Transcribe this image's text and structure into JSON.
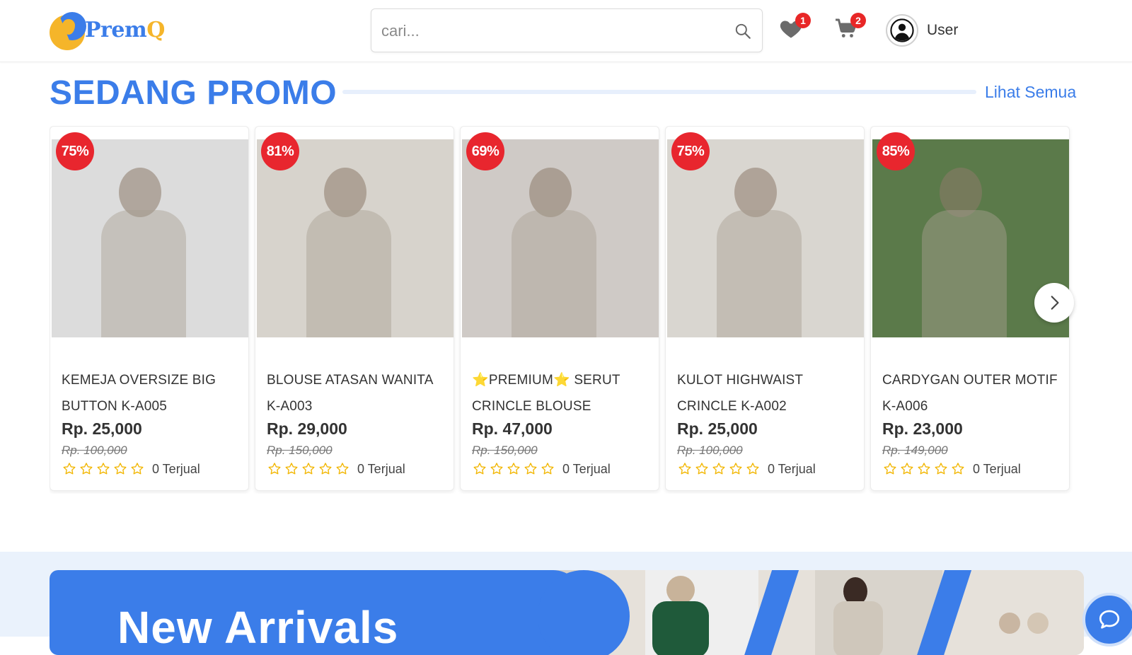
{
  "header": {
    "logo_text_main": "Prem",
    "logo_text_accent": "Q",
    "search_placeholder": "cari...",
    "wishlist_count": "1",
    "cart_count": "2",
    "user_name": "User"
  },
  "promo": {
    "title": "SEDANG PROMO",
    "see_all": "Lihat Semua",
    "products": [
      {
        "name": "KEMEJA OVERSIZE BIG BUTTON K-A005",
        "discount": "75%",
        "price": "Rp. 25,000",
        "old_price": "Rp. 100,000",
        "sold": "0 Terjual",
        "stars": 5,
        "rating": 0,
        "photo_bg": "#dcdcdc"
      },
      {
        "name": "BLOUSE ATASAN WANITA K-A003",
        "discount": "81%",
        "price": "Rp. 29,000",
        "old_price": "Rp. 150,000",
        "sold": "0 Terjual",
        "stars": 5,
        "rating": 0,
        "photo_bg": "#d7d3cc"
      },
      {
        "name": "⭐PREMIUM⭐ SERUT CRINCLE BLOUSE",
        "discount": "69%",
        "price": "Rp. 47,000",
        "old_price": "Rp. 150,000",
        "sold": "0 Terjual",
        "stars": 5,
        "rating": 0,
        "photo_bg": "#cfcac6"
      },
      {
        "name": "KULOT HIGHWAIST CRINCLE K-A002",
        "discount": "75%",
        "price": "Rp. 25,000",
        "old_price": "Rp. 100,000",
        "sold": "0 Terjual",
        "stars": 5,
        "rating": 0,
        "photo_bg": "#d9d6d0"
      },
      {
        "name": "CARDYGAN OUTER MOTIF K-A006",
        "discount": "85%",
        "price": "Rp. 23,000",
        "old_price": "Rp. 149,000",
        "sold": "0 Terjual",
        "stars": 5,
        "rating": 0,
        "photo_bg": "#5b7a4a"
      }
    ]
  },
  "banner": {
    "title": "New Arrivals"
  },
  "colors": {
    "brand_blue": "#3b7de9",
    "brand_yellow": "#f5b52a",
    "discount_red": "#e8262e",
    "star_yellow": "#f2b705"
  },
  "icons": {
    "search": "search-icon",
    "wishlist": "heart-icon",
    "cart": "cart-icon",
    "user": "user-icon",
    "next": "chevron-right-icon",
    "chat": "chat-icon",
    "star": "star-outline-icon"
  }
}
